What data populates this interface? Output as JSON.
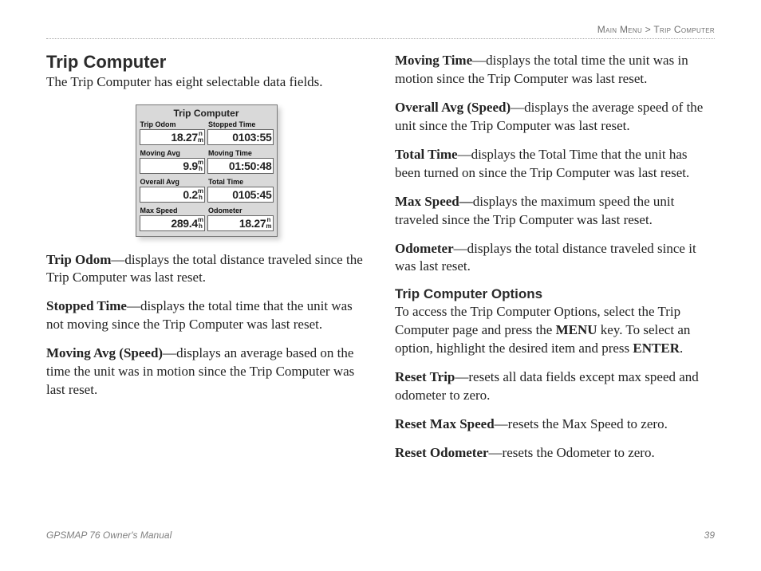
{
  "breadcrumb": {
    "section": "Main Menu",
    "sep": " > ",
    "page": "Trip Computer"
  },
  "title": "Trip Computer",
  "intro": "The Trip Computer has eight selectable data fields.",
  "device": {
    "title": "Trip Computer",
    "fields": [
      {
        "label": "Trip Odom",
        "value": "18.27",
        "unit": "n",
        "unit2": "m"
      },
      {
        "label": "Stopped Time",
        "value": "0103:55",
        "unit": ""
      },
      {
        "label": "Moving Avg",
        "value": "9.9",
        "unit": "m",
        "unit2": "h"
      },
      {
        "label": "Moving Time",
        "value": "01:50:48",
        "unit": ""
      },
      {
        "label": "Overall Avg",
        "value": "0.2",
        "unit": "m",
        "unit2": "h"
      },
      {
        "label": "Total Time",
        "value": "0105:45",
        "unit": ""
      },
      {
        "label": "Max Speed",
        "value": "289.4",
        "unit": "m",
        "unit2": "h"
      },
      {
        "label": "Odometer",
        "value": "18.27",
        "unit": "n",
        "unit2": "m"
      }
    ]
  },
  "defs_left": [
    {
      "term": "Trip Odom",
      "rest": "—displays the total distance traveled since the Trip Computer was last reset."
    },
    {
      "term": "Stopped Time",
      "rest": "—displays the total time that the unit was not moving since the Trip Computer was last reset."
    },
    {
      "term": "Moving Avg (Speed)",
      "rest": "—displays an average based on the time the unit was in motion since the Trip Computer was last reset."
    }
  ],
  "defs_right_top": [
    {
      "term": "Moving Time",
      "rest": "—displays the total time the unit was in motion since the Trip Computer was last reset."
    },
    {
      "term": "Overall Avg (Speed)",
      "rest": "—displays the average speed of the unit since the Trip Computer was last reset."
    },
    {
      "term": "Total Time",
      "rest": "—displays the Total Time that the unit has been turned on since the Trip Computer was last reset."
    },
    {
      "term": "Max Speed—",
      "rest": "displays the maximum speed the unit traveled since the Trip Computer was last reset."
    },
    {
      "term": "Odometer",
      "rest": "—displays the total distance traveled since it was last reset."
    }
  ],
  "options_head": "Trip Computer Options",
  "options_intro_1": "To access the Trip Computer Options, select the Trip Computer page and press the ",
  "options_intro_menu": "MENU",
  "options_intro_2": " key. To select an option, highlight the desired item and press ",
  "options_intro_enter": "ENTER",
  "options_intro_3": ".",
  "defs_options": [
    {
      "term": "Reset Trip",
      "rest": "—resets all data fields except max speed and odometer to zero."
    },
    {
      "term": "Reset Max Speed",
      "rest": "—resets the Max Speed to zero."
    },
    {
      "term": "Reset Odometer",
      "rest": "—resets the Odometer to zero."
    }
  ],
  "footer": {
    "left": "GPSMAP 76 Owner's Manual",
    "right": "39"
  }
}
